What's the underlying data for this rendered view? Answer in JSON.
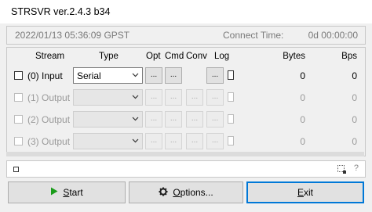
{
  "window": {
    "title": "STRSVR ver.2.4.3 b34"
  },
  "status": {
    "datetime": "2022/01/13 05:36:09 GPST",
    "connect_label": "Connect Time:",
    "connect_value": "0d 00:00:00"
  },
  "columns": {
    "stream": "Stream",
    "type": "Type",
    "opt": "Opt",
    "cmd": "Cmd",
    "conv": "Conv",
    "log": "Log",
    "bytes": "Bytes",
    "bps": "Bps"
  },
  "streams": [
    {
      "label": "(0) Input",
      "type": "Serial",
      "opt": "...",
      "cmd": "...",
      "conv": "",
      "log": "...",
      "bytes": "0",
      "bps": "0",
      "enabled": true
    },
    {
      "label": "(1) Output",
      "type": "",
      "opt": "...",
      "cmd": "...",
      "conv": "...",
      "log": "...",
      "bytes": "0",
      "bps": "0",
      "enabled": false
    },
    {
      "label": "(2) Output",
      "type": "",
      "opt": "...",
      "cmd": "...",
      "conv": "...",
      "log": "...",
      "bytes": "0",
      "bps": "0",
      "enabled": false
    },
    {
      "label": "(3) Output",
      "type": "",
      "opt": "...",
      "cmd": "...",
      "conv": "...",
      "log": "...",
      "bytes": "0",
      "bps": "0",
      "enabled": false
    }
  ],
  "log": {
    "help_mark": "?"
  },
  "buttons": {
    "start_underlined": "S",
    "start_rest": "tart",
    "options_underlined": "O",
    "options_rest": "ptions...",
    "exit_underlined": "E",
    "exit_rest": "xit"
  },
  "icons": {
    "start": "play-icon",
    "options": "gear-icon",
    "dropdown": "chevron-down-icon"
  },
  "colors": {
    "start_icon": "#1a9c1a",
    "focus_border": "#0078d7",
    "disabled_text": "#9a9a9a"
  }
}
